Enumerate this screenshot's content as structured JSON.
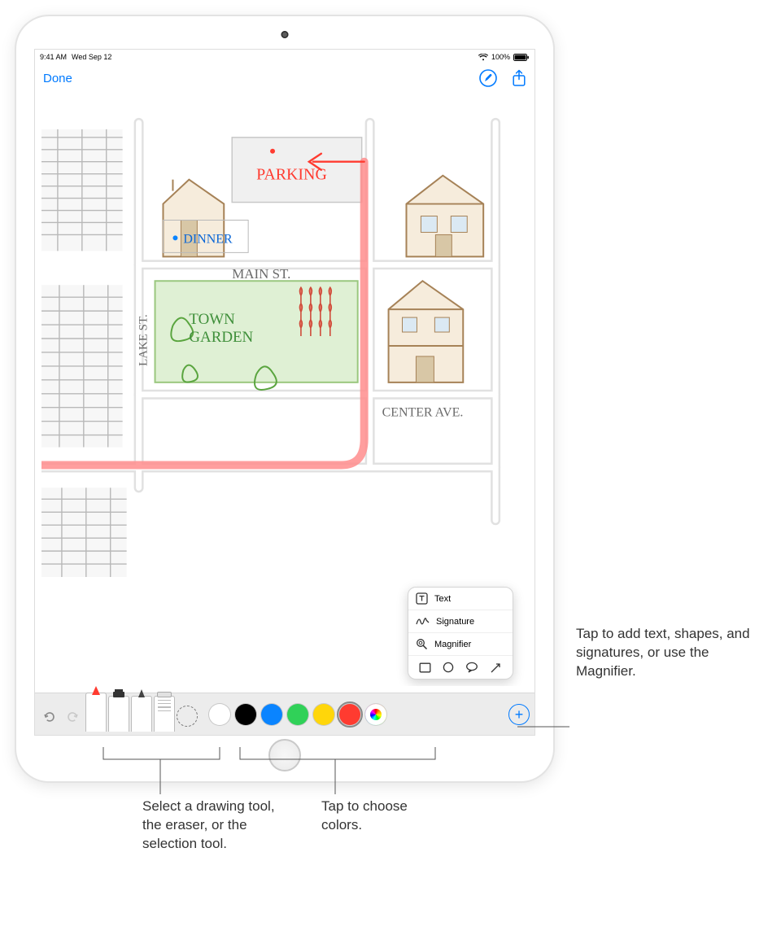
{
  "status": {
    "time": "9:41 AM",
    "date": "Wed Sep 12",
    "battery_percent": "100%"
  },
  "nav": {
    "done_label": "Done"
  },
  "sketch_labels": {
    "parking": "PARKING",
    "dinner": "DINNER",
    "main_st": "MAIN ST.",
    "town_garden_1": "TOWN",
    "town_garden_2": "GARDEN",
    "lake_st": "LAKE ST.",
    "center_ave": "CENTER AVE."
  },
  "popover": {
    "text": "Text",
    "signature": "Signature",
    "magnifier": "Magnifier"
  },
  "toolbar": {
    "colors": [
      "#ffffff",
      "#000000",
      "#0a84ff",
      "#30d158",
      "#ffd60a",
      "#ff3b30"
    ],
    "selected_color_index": 5
  },
  "callouts": {
    "add": "Tap to add text, shapes, and signatures, or use the Magnifier.",
    "tools": "Select a drawing tool, the eraser, or the selection tool.",
    "colors": "Tap to choose colors."
  }
}
